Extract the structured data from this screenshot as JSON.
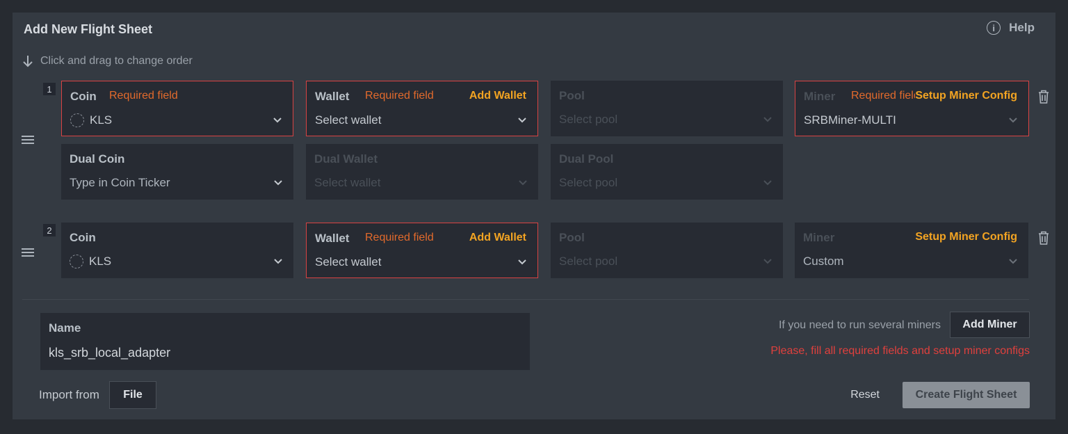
{
  "header": {
    "title": "Add New Flight Sheet",
    "help_label": "Help"
  },
  "hint": "Click and drag to change order",
  "miners": [
    {
      "index": "1",
      "coin": {
        "label": "Coin",
        "required": "Required field",
        "value": "KLS"
      },
      "wallet": {
        "label": "Wallet",
        "required": "Required field",
        "action": "Add Wallet",
        "placeholder": "Select wallet"
      },
      "pool": {
        "label": "Pool",
        "placeholder": "Select pool"
      },
      "miner": {
        "label": "Miner",
        "required": "Required field",
        "action": "Setup Miner Config",
        "value": "SRBMiner-MULTI"
      },
      "dual_coin": {
        "label": "Dual Coin",
        "placeholder": "Type in Coin Ticker"
      },
      "dual_wallet": {
        "label": "Dual Wallet",
        "placeholder": "Select wallet"
      },
      "dual_pool": {
        "label": "Dual Pool",
        "placeholder": "Select pool"
      }
    },
    {
      "index": "2",
      "coin": {
        "label": "Coin",
        "value": "KLS"
      },
      "wallet": {
        "label": "Wallet",
        "required": "Required field",
        "action": "Add Wallet",
        "placeholder": "Select wallet"
      },
      "pool": {
        "label": "Pool",
        "placeholder": "Select pool"
      },
      "miner": {
        "label": "Miner",
        "action": "Setup Miner Config",
        "value": "Custom"
      }
    }
  ],
  "name_field": {
    "label": "Name",
    "value": "kls_srb_local_adapter"
  },
  "add_miner": {
    "hint": "If you need to run several miners",
    "button": "Add Miner"
  },
  "error": "Please, fill all required fields and setup miner configs",
  "import": {
    "label": "Import from",
    "button": "File"
  },
  "footer": {
    "reset": "Reset",
    "create": "Create Flight Sheet"
  },
  "colors": {
    "required": "#e26a2c",
    "action": "#f3a422",
    "error": "#e0403d",
    "error_border": "#d94343"
  }
}
